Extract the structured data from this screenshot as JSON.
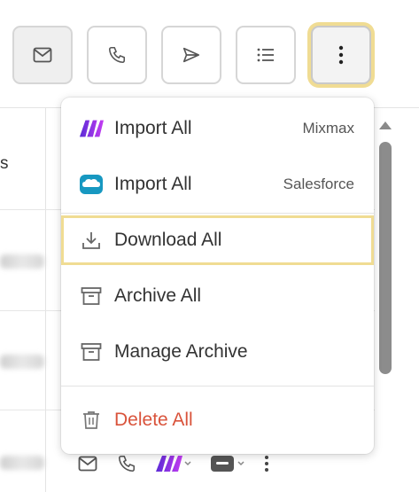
{
  "toolbar": {
    "buttons": [
      {
        "name": "email",
        "icon": "mail-icon"
      },
      {
        "name": "call",
        "icon": "phone-icon"
      },
      {
        "name": "send",
        "icon": "send-icon"
      },
      {
        "name": "list",
        "icon": "list-icon"
      },
      {
        "name": "more",
        "icon": "more-vertical-icon"
      }
    ]
  },
  "table": {
    "header_fragment": "s"
  },
  "menu": {
    "items": [
      {
        "label": "Import All",
        "source": "Mixmax",
        "icon": "mixmax-logo-icon"
      },
      {
        "label": "Import All",
        "source": "Salesforce",
        "icon": "salesforce-logo-icon"
      },
      {
        "label": "Download All",
        "icon": "download-icon"
      },
      {
        "label": "Archive All",
        "icon": "archive-icon"
      },
      {
        "label": "Manage Archive",
        "icon": "archive-icon"
      },
      {
        "label": "Delete All",
        "icon": "trash-icon"
      }
    ]
  },
  "colors": {
    "highlight": "#f0dc93",
    "danger": "#d9533b",
    "mixmax": "#7b2ff7",
    "salesforce": "#1798c1"
  }
}
